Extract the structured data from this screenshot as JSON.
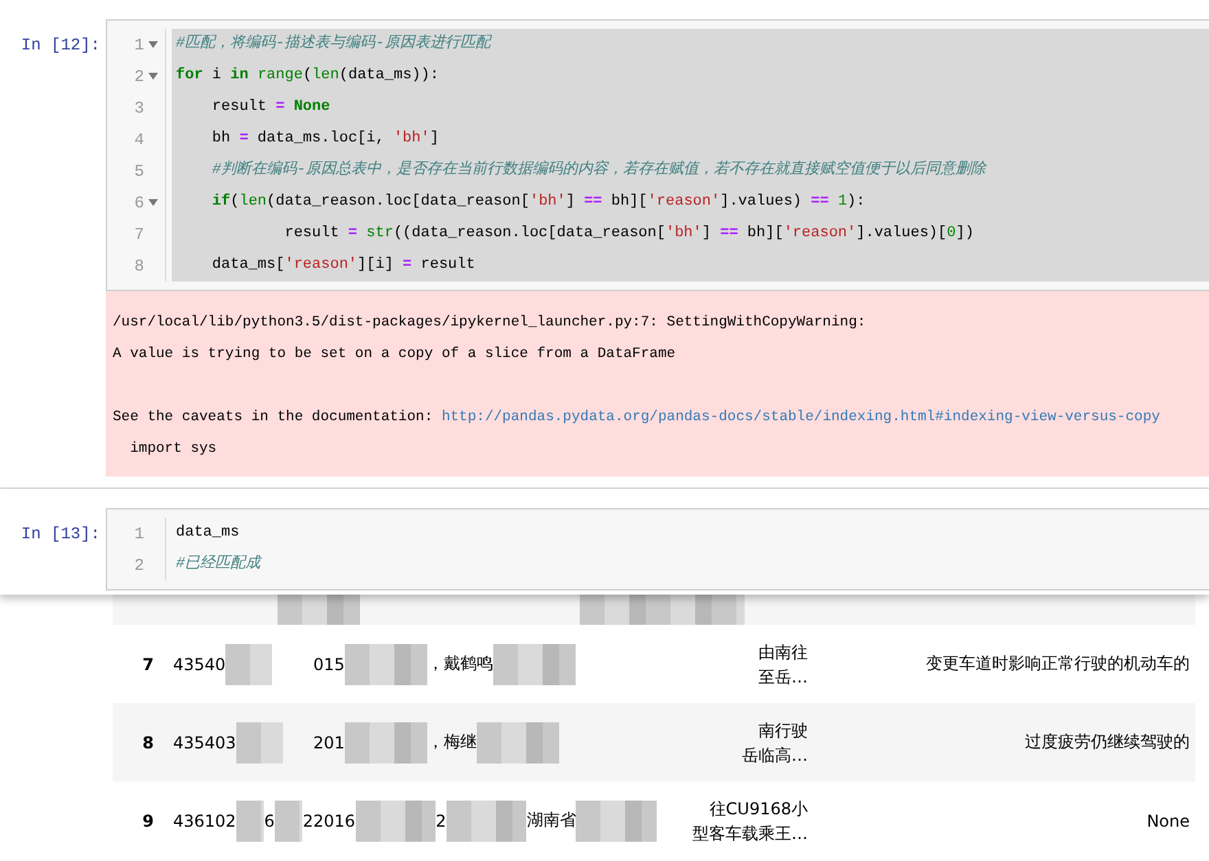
{
  "cells": [
    {
      "prompt": "In [12]:",
      "lines": [
        {
          "number": "1",
          "foldable": true,
          "highlighted": true,
          "tokens": [
            {
              "kind": "comment",
              "text": "#匹配，将编码-描述表与编码-原因表进行匹配"
            }
          ]
        },
        {
          "number": "2",
          "foldable": true,
          "highlighted": true,
          "tokens": [
            {
              "kind": "keyword",
              "text": "for"
            },
            {
              "kind": "plain",
              "text": " i "
            },
            {
              "kind": "keyword",
              "text": "in "
            },
            {
              "kind": "builtin",
              "text": "range"
            },
            {
              "kind": "plain",
              "text": "("
            },
            {
              "kind": "builtin",
              "text": "len"
            },
            {
              "kind": "plain",
              "text": "(data_ms)):"
            }
          ]
        },
        {
          "number": "3",
          "foldable": false,
          "highlighted": true,
          "tokens": [
            {
              "kind": "plain",
              "text": "    result "
            },
            {
              "kind": "op",
              "text": "= "
            },
            {
              "kind": "keyword",
              "text": "None"
            }
          ]
        },
        {
          "number": "4",
          "foldable": false,
          "highlighted": true,
          "tokens": [
            {
              "kind": "plain",
              "text": "    bh "
            },
            {
              "kind": "op",
              "text": "="
            },
            {
              "kind": "plain",
              "text": " data_ms.loc[i, "
            },
            {
              "kind": "string",
              "text": "'bh'"
            },
            {
              "kind": "plain",
              "text": "]"
            }
          ]
        },
        {
          "number": "5",
          "foldable": false,
          "highlighted": true,
          "tokens": [
            {
              "kind": "comment",
              "text": "    #判断在编码-原因总表中，是否存在当前行数据编码的内容，若存在赋值，若不存在就直接赋空值便于以后同意删除"
            }
          ]
        },
        {
          "number": "6",
          "foldable": true,
          "highlighted": true,
          "tokens": [
            {
              "kind": "keyword",
              "text": "    if"
            },
            {
              "kind": "plain",
              "text": "("
            },
            {
              "kind": "builtin",
              "text": "len"
            },
            {
              "kind": "plain",
              "text": "(data_reason.loc[data_reason["
            },
            {
              "kind": "string",
              "text": "'bh'"
            },
            {
              "kind": "plain",
              "text": "] "
            },
            {
              "kind": "op",
              "text": "=="
            },
            {
              "kind": "plain",
              "text": " bh]["
            },
            {
              "kind": "string",
              "text": "'reason'"
            },
            {
              "kind": "plain",
              "text": "].values) "
            },
            {
              "kind": "op",
              "text": "== "
            },
            {
              "kind": "number",
              "text": "1"
            },
            {
              "kind": "plain",
              "text": "):"
            }
          ]
        },
        {
          "number": "7",
          "foldable": false,
          "highlighted": true,
          "tokens": [
            {
              "kind": "plain",
              "text": "            result "
            },
            {
              "kind": "op",
              "text": "= "
            },
            {
              "kind": "builtin",
              "text": "str"
            },
            {
              "kind": "plain",
              "text": "((data_reason.loc[data_reason["
            },
            {
              "kind": "string",
              "text": "'bh'"
            },
            {
              "kind": "plain",
              "text": "] "
            },
            {
              "kind": "op",
              "text": "=="
            },
            {
              "kind": "plain",
              "text": " bh]["
            },
            {
              "kind": "string",
              "text": "'reason'"
            },
            {
              "kind": "plain",
              "text": "].values)["
            },
            {
              "kind": "number",
              "text": "0"
            },
            {
              "kind": "plain",
              "text": "])"
            }
          ]
        },
        {
          "number": "8",
          "foldable": false,
          "highlighted": true,
          "tokens": [
            {
              "kind": "plain",
              "text": "    data_ms["
            },
            {
              "kind": "string",
              "text": "'reason'"
            },
            {
              "kind": "plain",
              "text": "][i] "
            },
            {
              "kind": "op",
              "text": "="
            },
            {
              "kind": "plain",
              "text": " result"
            }
          ]
        }
      ],
      "output": {
        "kind": "stderr",
        "lines": [
          {
            "text": "/usr/local/lib/python3.5/dist-packages/ipykernel_launcher.py:7: SettingWithCopyWarning:"
          },
          {
            "text": "A value is trying to be set on a copy of a slice from a DataFrame"
          },
          {
            "text": "See the caveats in the documentation: ",
            "link": "http://pandas.pydata.org/pandas-docs/stable/indexing.html#indexing-view-versus-copy",
            "blank_before": true
          },
          {
            "text": "  import sys"
          }
        ]
      }
    },
    {
      "prompt": "In [13]:",
      "lines": [
        {
          "number": "1",
          "foldable": false,
          "highlighted": false,
          "tokens": [
            {
              "kind": "plain",
              "text": "data_ms"
            }
          ]
        },
        {
          "number": "2",
          "foldable": false,
          "highlighted": false,
          "tokens": [
            {
              "kind": "comment",
              "text": "#已经匹配成"
            }
          ]
        }
      ]
    }
  ],
  "table": {
    "rows": [
      {
        "index": "7",
        "id_parts": [
          "43540"
        ],
        "detail_parts": [
          "015",
          "，戴鹤鸣"
        ],
        "desc_lines": [
          "由南往",
          "至岳…"
        ],
        "reason": "变更车道时影响正常行驶的机动车的"
      },
      {
        "index": "8",
        "id_parts": [
          "435403"
        ],
        "detail_parts": [
          "201",
          "，梅继"
        ],
        "desc_lines": [
          "南行驶",
          "岳临高…"
        ],
        "reason": "过度疲劳仍继续驾驶的"
      },
      {
        "index": "9",
        "id_parts": [
          "436102",
          "6",
          "2"
        ],
        "detail_parts": [
          "2016",
          "2",
          "湖南省"
        ],
        "desc_lines": [
          "往CU9168小",
          "型客车载乘王…"
        ],
        "reason": "None"
      }
    ]
  }
}
